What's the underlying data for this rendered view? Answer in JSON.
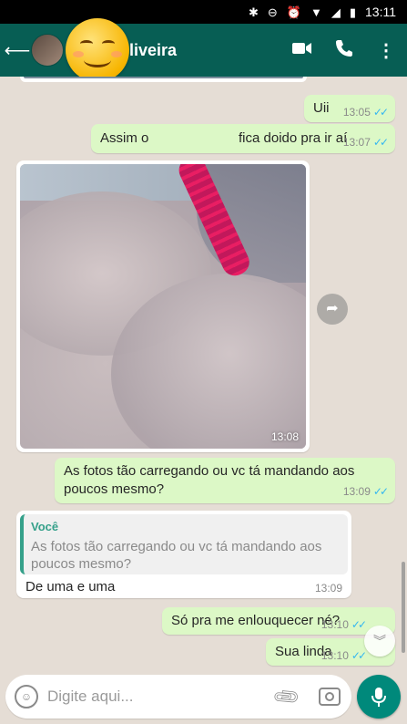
{
  "status_bar": {
    "time": "13:11",
    "icons": [
      "bluetooth-icon",
      "dnd-icon",
      "alarm-icon",
      "wifi-icon",
      "signal-icon",
      "battery-icon"
    ]
  },
  "header": {
    "contact_name": "Oliveira",
    "back_icon": "arrow-left-icon",
    "video_icon": "video-call-icon",
    "call_icon": "phone-icon",
    "menu_icon": "more-vert-icon",
    "bg_color": "#075e54"
  },
  "messages": [
    {
      "dir": "out",
      "text": "Uii",
      "time": "13:05",
      "ticks": "✓✓"
    },
    {
      "dir": "out",
      "text": "Assim o",
      "text2": "fica doido pra ir aí",
      "time": "13:07",
      "ticks": "✓✓"
    },
    {
      "dir": "in",
      "type": "image",
      "time": "13:08"
    },
    {
      "dir": "out",
      "text": "As fotos tão carregando ou vc tá mandando aos poucos mesmo?",
      "time": "13:09",
      "ticks": "✓✓"
    },
    {
      "dir": "in",
      "type": "reply",
      "quote_author": "Você",
      "quote_text": "As fotos tão carregando ou vc tá mandando aos poucos mesmo?",
      "text": "De uma e uma",
      "time": "13:09"
    },
    {
      "dir": "out",
      "text": "Só pra me enlouquecer né?",
      "time": "13:10",
      "ticks": "✓✓"
    },
    {
      "dir": "out",
      "text": "Sua linda",
      "time": "13:10",
      "ticks": "✓✓"
    }
  ],
  "composer": {
    "placeholder": "Digite aqui...",
    "emoji_icon": "emoji-icon",
    "attach_icon": "paperclip-icon",
    "camera_icon": "camera-icon",
    "mic_icon": "mic-icon"
  },
  "colors": {
    "outgoing": "#dcf8c6",
    "incoming": "#ffffff",
    "ticks": "#34b7f1",
    "accent": "#00897b"
  }
}
